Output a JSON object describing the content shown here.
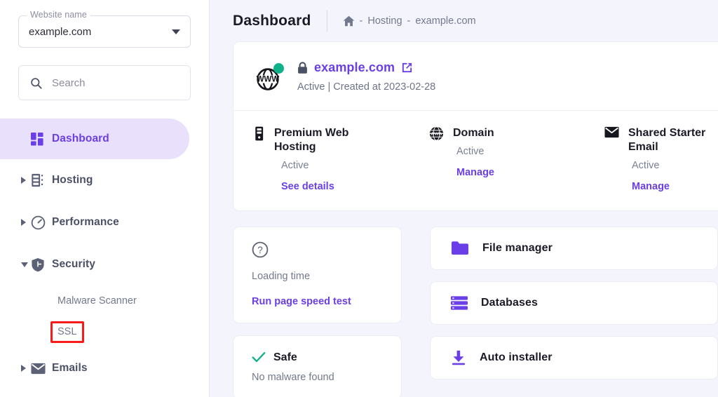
{
  "sidebar": {
    "website_field": {
      "legend": "Website name",
      "value": "example.com"
    },
    "search": {
      "placeholder": "Search"
    },
    "items": [
      {
        "label": "Dashboard",
        "icon": "grid-icon",
        "active": true,
        "expandable": false
      },
      {
        "label": "Hosting",
        "icon": "server-icon",
        "active": false,
        "expandable": true,
        "expanded": false
      },
      {
        "label": "Performance",
        "icon": "speedometer-icon",
        "active": false,
        "expandable": true,
        "expanded": false
      },
      {
        "label": "Security",
        "icon": "shield-icon",
        "active": false,
        "expandable": true,
        "expanded": true
      },
      {
        "label": "Emails",
        "icon": "envelope-icon",
        "active": false,
        "expandable": true,
        "expanded": false
      }
    ],
    "security_children": [
      {
        "label": "Malware Scanner",
        "highlighted": false
      },
      {
        "label": "SSL",
        "highlighted": true
      }
    ]
  },
  "header": {
    "title": "Dashboard",
    "breadcrumb": {
      "home_icon": "home-icon",
      "sep1": "-",
      "level1": "Hosting",
      "sep2": "-",
      "level2": "example.com"
    }
  },
  "hero": {
    "site_icon": "www-globe-icon",
    "status_dot": "green-status-dot",
    "lock_icon": "lock-icon",
    "domain": "example.com",
    "external_icon": "external-link-icon",
    "meta": "Active | Created at 2023-02-28"
  },
  "services": [
    {
      "icon": "server-icon",
      "title": "Premium Web Hosting",
      "status": "Active",
      "link": "See details"
    },
    {
      "icon": "www-globe-icon",
      "title": "Domain",
      "status": "Active",
      "link": "Manage"
    },
    {
      "icon": "envelope-icon",
      "title": "Shared Starter Email",
      "status": "Active",
      "link": "Manage"
    }
  ],
  "loading_card": {
    "icon": "question-circle-icon",
    "label": "Loading time",
    "link": "Run page speed test"
  },
  "safe_card": {
    "icon": "check-icon",
    "title": "Safe",
    "subtitle": "No malware found"
  },
  "actions": [
    {
      "icon": "folder-icon",
      "label": "File manager"
    },
    {
      "icon": "database-icon",
      "label": "Databases"
    },
    {
      "icon": "download-icon",
      "label": "Auto installer"
    }
  ],
  "colors": {
    "accent": "#6b3fe8",
    "accent_light": "#e9e1fb",
    "green": "#0fb18a",
    "annotation": "#f81b1b",
    "page_bg": "#f4f4fc"
  }
}
